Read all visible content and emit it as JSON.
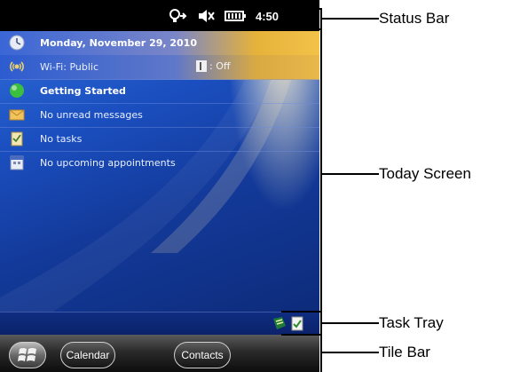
{
  "status_bar": {
    "time": "4:50",
    "icons": [
      "connectivity-icon",
      "speaker-mute-icon",
      "battery-icon"
    ]
  },
  "today": {
    "rows": [
      {
        "icon": "clock-icon",
        "text": "Monday, November 29, 2010",
        "bold": true
      },
      {
        "icon": "wifi-icon",
        "text": "Wi-Fi: Public",
        "bold": false
      },
      {
        "icon": "getting-started-icon",
        "text": "Getting Started",
        "bold": true
      },
      {
        "icon": "envelope-icon",
        "text": "No unread messages",
        "bold": false
      },
      {
        "icon": "tasks-icon",
        "text": "No tasks",
        "bold": false
      },
      {
        "icon": "calendar-icon",
        "text": "No upcoming appointments",
        "bold": false
      }
    ],
    "bluetooth_status": ": Off"
  },
  "task_tray": {
    "icons": [
      "sync-icon",
      "tray-app-icon"
    ]
  },
  "tile_bar": {
    "start_icon": "windows-start-icon",
    "tiles": [
      "Calendar",
      "Contacts"
    ]
  },
  "callouts": {
    "status_bar": "Status Bar",
    "today_screen": "Today Screen",
    "task_tray": "Task Tray",
    "tile_bar": "Tile Bar"
  }
}
